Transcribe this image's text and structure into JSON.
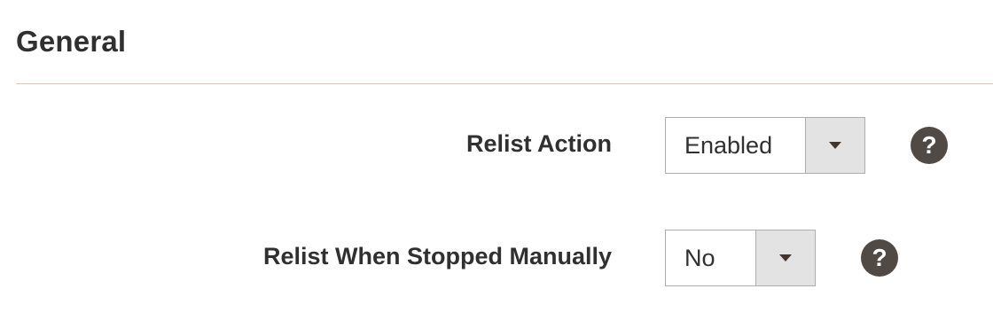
{
  "section": {
    "title": "General"
  },
  "fields": [
    {
      "label": "Relist Action",
      "value": "Enabled"
    },
    {
      "label": "Relist When Stopped Manually",
      "value": "No"
    }
  ],
  "icons": {
    "help": "question-mark-icon",
    "dropdown": "caret-down-icon",
    "help_glyph": "?"
  },
  "colors": {
    "text": "#303030",
    "help_bg": "#514943",
    "arrow_bg": "#e3e3e3",
    "divider": "#d6c8be"
  }
}
